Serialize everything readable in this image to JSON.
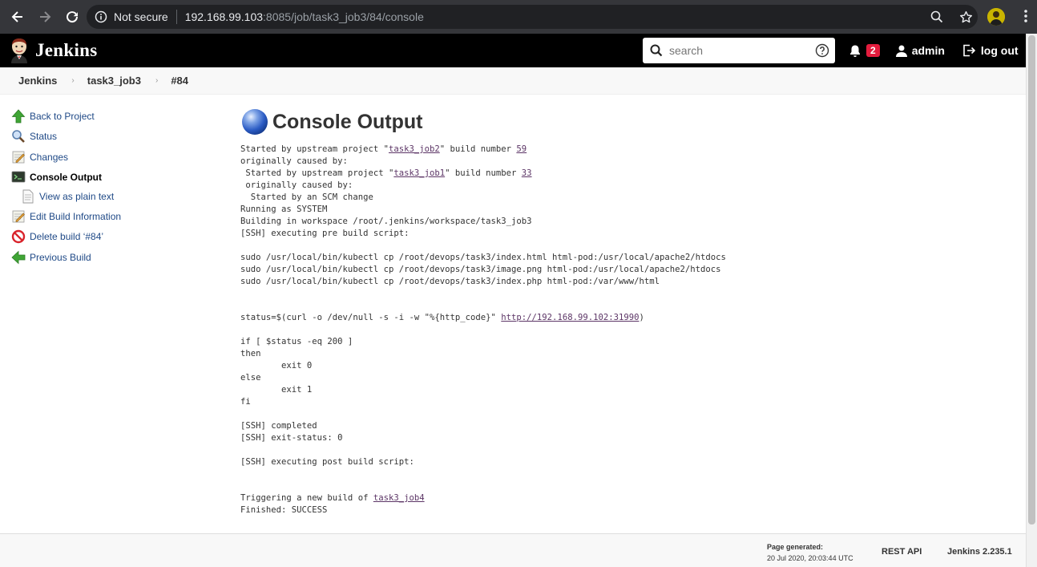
{
  "browser": {
    "security_label": "Not secure",
    "url_host": "192.168.99.103",
    "url_rest": ":8085/job/task3_job3/84/console"
  },
  "header": {
    "app_title": "Jenkins",
    "search_placeholder": "search",
    "notification_count": "2",
    "username": "admin",
    "logout_label": "log out"
  },
  "breadcrumb": [
    "Jenkins",
    "task3_job3",
    "#84"
  ],
  "sidebar": {
    "items": [
      {
        "label": "Back to Project",
        "icon": "up-arrow-icon"
      },
      {
        "label": "Status",
        "icon": "magnifier-icon"
      },
      {
        "label": "Changes",
        "icon": "notepad-icon"
      },
      {
        "label": "Console Output",
        "icon": "terminal-icon"
      },
      {
        "label": "View as plain text",
        "icon": "document-icon"
      },
      {
        "label": "Edit Build Information",
        "icon": "notepad-icon"
      },
      {
        "label": "Delete build ‘#84’",
        "icon": "no-entry-icon"
      },
      {
        "label": "Previous Build",
        "icon": "left-arrow-icon"
      }
    ]
  },
  "content": {
    "title": "Console Output",
    "console_lines": [
      [
        {
          "t": "Started by upstream project \""
        },
        {
          "t": "task3_job2",
          "link": true
        },
        {
          "t": "\" build number "
        },
        {
          "t": "59",
          "link": true
        }
      ],
      [
        {
          "t": "originally caused by:"
        }
      ],
      [
        {
          "t": " Started by upstream project \""
        },
        {
          "t": "task3_job1",
          "link": true
        },
        {
          "t": "\" build number "
        },
        {
          "t": "33",
          "link": true
        }
      ],
      [
        {
          "t": " originally caused by:"
        }
      ],
      [
        {
          "t": "  Started by an SCM change"
        }
      ],
      [
        {
          "t": "Running as SYSTEM"
        }
      ],
      [
        {
          "t": "Building in workspace /root/.jenkins/workspace/task3_job3"
        }
      ],
      [
        {
          "t": "[SSH] executing pre build script:"
        }
      ],
      [
        {
          "t": ""
        }
      ],
      [
        {
          "t": "sudo /usr/local/bin/kubectl cp /root/devops/task3/index.html html-pod:/usr/local/apache2/htdocs"
        }
      ],
      [
        {
          "t": "sudo /usr/local/bin/kubectl cp /root/devops/task3/image.png html-pod:/usr/local/apache2/htdocs"
        }
      ],
      [
        {
          "t": "sudo /usr/local/bin/kubectl cp /root/devops/task3/index.php html-pod:/var/www/html"
        }
      ],
      [
        {
          "t": ""
        }
      ],
      [
        {
          "t": ""
        }
      ],
      [
        {
          "t": "status=$(curl -o /dev/null -s -i -w \"%{http_code}\" "
        },
        {
          "t": "http://192.168.99.102:31990",
          "link": true
        },
        {
          "t": ")"
        }
      ],
      [
        {
          "t": ""
        }
      ],
      [
        {
          "t": "if [ $status -eq 200 ]"
        }
      ],
      [
        {
          "t": "then"
        }
      ],
      [
        {
          "t": "        exit 0"
        }
      ],
      [
        {
          "t": "else"
        }
      ],
      [
        {
          "t": "        exit 1"
        }
      ],
      [
        {
          "t": "fi"
        }
      ],
      [
        {
          "t": ""
        }
      ],
      [
        {
          "t": "[SSH] completed"
        }
      ],
      [
        {
          "t": "[SSH] exit-status: 0"
        }
      ],
      [
        {
          "t": ""
        }
      ],
      [
        {
          "t": "[SSH] executing post build script:"
        }
      ],
      [
        {
          "t": ""
        }
      ],
      [
        {
          "t": ""
        }
      ],
      [
        {
          "t": "Triggering a new build of "
        },
        {
          "t": "task3_job4",
          "link": true
        }
      ],
      [
        {
          "t": "Finished: SUCCESS"
        }
      ]
    ]
  },
  "footer": {
    "page_generated_label": "Page generated:",
    "page_generated_time": "20 Jul 2020, 20:03:44 UTC",
    "rest_api": "REST API",
    "version": "Jenkins 2.235.1"
  },
  "colors": {
    "link": "#204a87",
    "console_link": "#5c3566",
    "badge": "#e31c3d"
  }
}
